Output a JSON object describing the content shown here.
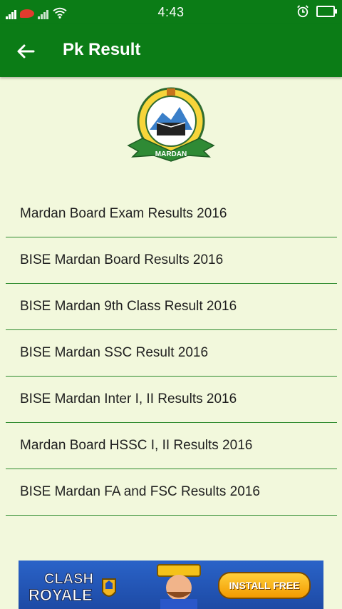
{
  "status_bar": {
    "time": "4:43"
  },
  "app_bar": {
    "title": "Pk Result"
  },
  "logo": {
    "text": "MARDAN"
  },
  "results": [
    {
      "label": "Mardan Board Exam Results 2016"
    },
    {
      "label": "BISE Mardan Board Results 2016"
    },
    {
      "label": "BISE Mardan 9th Class Result 2016"
    },
    {
      "label": "BISE Mardan SSC Result 2016"
    },
    {
      "label": "BISE Mardan Inter I, II Results 2016"
    },
    {
      "label": "Mardan Board HSSC I, II Results 2016"
    },
    {
      "label": "BISE Mardan FA and FSC Results 2016"
    }
  ],
  "ad": {
    "brand_line1": "CLASH",
    "brand_line2": "ROYALE",
    "install_label": "INSTALL FREE"
  },
  "colors": {
    "primary": "#0b7c16",
    "background": "#f2f8dc",
    "divider": "#2e8b2e"
  }
}
